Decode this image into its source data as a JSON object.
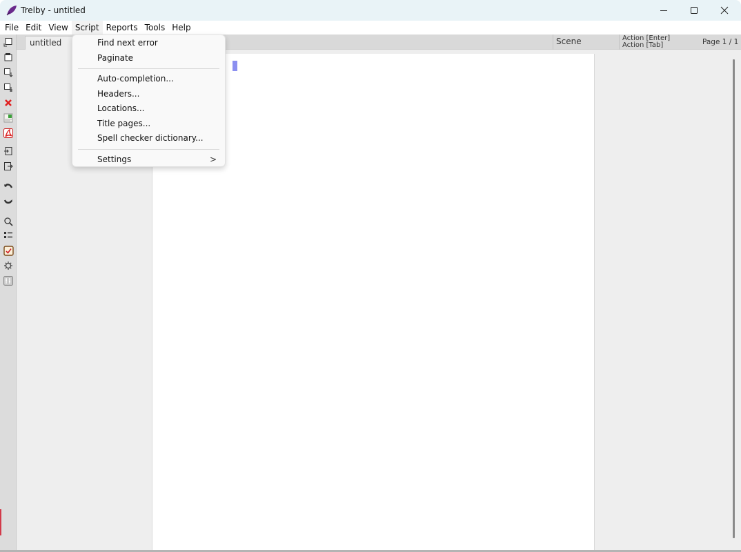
{
  "window": {
    "title": "Trelby - untitled",
    "controls": {
      "minimize": "minimize",
      "maximize": "maximize",
      "close": "close"
    }
  },
  "menubar": {
    "items": [
      {
        "label": "File"
      },
      {
        "label": "Edit"
      },
      {
        "label": "View"
      },
      {
        "label": "Script"
      },
      {
        "label": "Reports"
      },
      {
        "label": "Tools"
      },
      {
        "label": "Help"
      }
    ],
    "active": "Script"
  },
  "script_menu": {
    "groups": [
      [
        {
          "label": "Find next error"
        },
        {
          "label": "Paginate"
        }
      ],
      [
        {
          "label": "Auto-completion..."
        },
        {
          "label": "Headers..."
        },
        {
          "label": "Locations..."
        },
        {
          "label": "Title pages..."
        },
        {
          "label": "Spell checker dictionary..."
        }
      ],
      [
        {
          "label": "Settings",
          "submenu_arrow": ">"
        }
      ]
    ]
  },
  "toolbar": {
    "tools": [
      "new-icon",
      "open-icon",
      "save-icon",
      "save-as-icon",
      "close-icon",
      "import-script-icon",
      "export-pdf-icon",
      "import-icon",
      "export-icon",
      "undo-icon",
      "redo-icon",
      "find-icon",
      "element-list-icon",
      "spell-check-icon",
      "settings-gear-icon",
      "character-tool-icon"
    ]
  },
  "tabs": [
    {
      "label": "untitled"
    }
  ],
  "statusbar": {
    "element": "Scene",
    "enter_hint": "Action [Enter]",
    "tab_hint": "Action [Tab]",
    "page": "Page 1 / 1"
  },
  "colors": {
    "cursor": "#8b8ff0",
    "titlebar": "#e9f3f7",
    "workspace": "#eeeeee",
    "toolbar": "#dcdcdc"
  }
}
